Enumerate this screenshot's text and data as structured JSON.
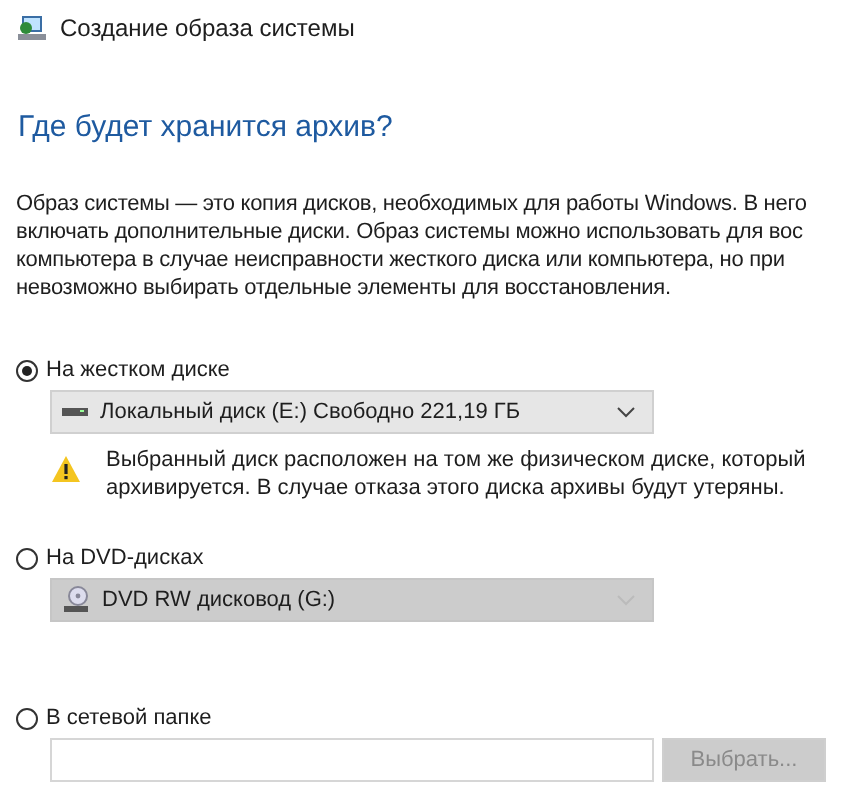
{
  "window": {
    "title": "Создание образа системы"
  },
  "heading": "Где будет хранится архив?",
  "description": "Образ системы — это копия дисков, необходимых для работы Windows. В него\nвключать дополнительные диски. Образ системы можно использовать для вос\nкомпьютера в случае неисправности жесткого диска или компьютера, но при\nневозможно выбирать отдельные элементы для восстановления.",
  "options": [
    {
      "kind": "disk",
      "label": "На жестком диске",
      "selected": true,
      "value": "Локальный диск (E:)  Свободно 221,19 ГБ",
      "disabled": false,
      "warning": "Выбранный диск расположен на том же физическом диске, который\nархивируется. В случае отказа этого диска архивы будут утеряны."
    },
    {
      "kind": "dvd",
      "label": "На DVD-дисках",
      "selected": false,
      "value": "DVD RW дисковод (G:)",
      "disabled": true
    },
    {
      "kind": "folder",
      "label": "В сетевой папке",
      "selected": false,
      "button": "Выбрать...",
      "disabled": true
    }
  ]
}
